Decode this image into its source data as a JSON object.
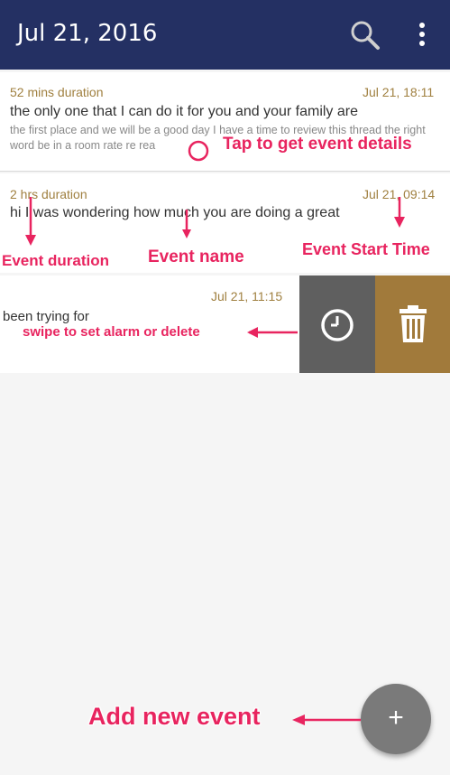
{
  "header": {
    "title": "Jul 21, 2016"
  },
  "events": [
    {
      "duration": "52 mins duration",
      "start_time": "Jul 21, 18:11",
      "name": "the only one that I can do it for you and your family are",
      "description": "the first place and we will be a good day I have a time to review this thread the right word be in a room rate re rea"
    },
    {
      "duration": "2 hrs duration",
      "start_time": "Jul 21, 09:14",
      "name": "hi I was wondering how much you are doing a great",
      "description": ""
    },
    {
      "duration": "",
      "start_time": "Jul 21, 11:15",
      "name": "been trying for",
      "description": ""
    }
  ],
  "annotations": {
    "tap_details": "Tap to get event details",
    "event_duration": "Event duration",
    "event_name": "Event name",
    "event_start_time": "Event Start Time",
    "swipe": "swipe to set alarm or delete",
    "add_event": "Add new event"
  },
  "icons": {
    "search": "search-icon",
    "menu": "more-vert-icon",
    "alarm": "clock-icon",
    "delete": "trash-icon",
    "add": "plus-icon"
  },
  "colors": {
    "appbar": "#243063",
    "accent_text": "#a08040",
    "annotation": "#e8245f",
    "alarm_action": "#5f5f5f",
    "delete_action": "#a17a3b",
    "fab": "#7a7a7a"
  },
  "fab": {
    "label": "+"
  }
}
